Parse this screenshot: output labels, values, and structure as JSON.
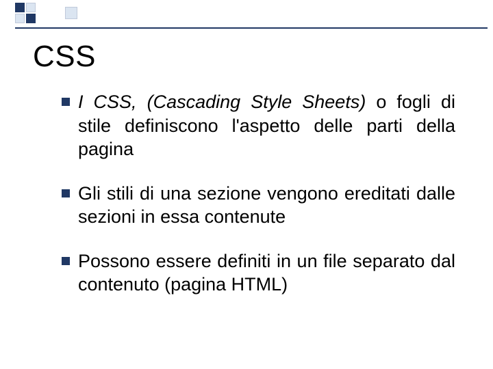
{
  "title": "CSS",
  "bullets": [
    {
      "italic": "I CSS, (Cascading Style Sheets)",
      "rest": " o fogli di stile definiscono l'aspetto delle parti della pagina"
    },
    {
      "italic": "",
      "rest": "Gli stili di una sezione vengono ereditati dalle sezioni in essa contenute"
    },
    {
      "italic": "",
      "rest": "Possono essere definiti in un file separato dal contenuto (pagina HTML)"
    }
  ]
}
